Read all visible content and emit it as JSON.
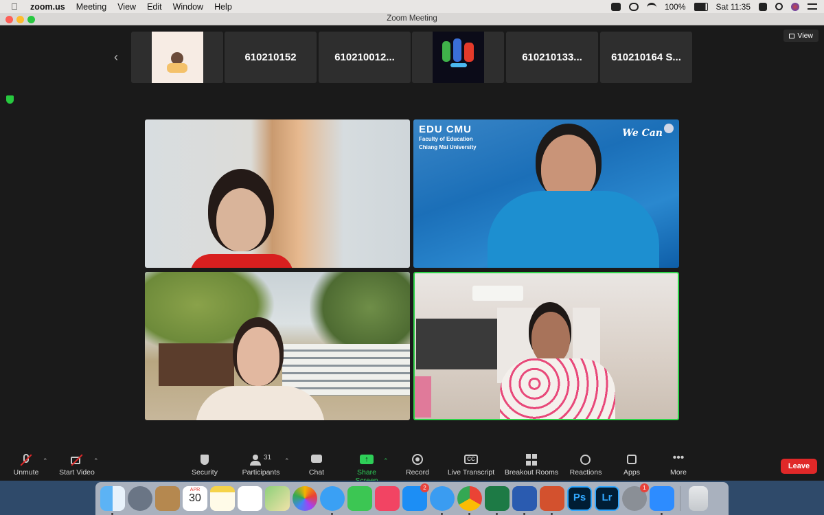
{
  "menubar": {
    "app": "zoom.us",
    "menus": [
      "Meeting",
      "View",
      "Edit",
      "Window",
      "Help"
    ],
    "battery": "100%",
    "clock": "Sat 11:35"
  },
  "window": {
    "title": "Zoom Meeting"
  },
  "view_button": "View",
  "thumbnails": [
    "610210152",
    "610210012...",
    "610210133...",
    "610210164 S..."
  ],
  "tiles": {
    "edu_title": "EDU CMU",
    "edu_line1": "Faculty of Education",
    "edu_line2": "Chiang Mai University",
    "we_can": "We Can"
  },
  "toolbar": {
    "unmute": "Unmute",
    "start_video": "Start Video",
    "security": "Security",
    "participants": "Participants",
    "participants_count": "31",
    "chat": "Chat",
    "share_screen": "Share Screen",
    "record": "Record",
    "live_transcript": "Live Transcript",
    "breakout_rooms": "Breakout Rooms",
    "reactions": "Reactions",
    "apps": "Apps",
    "more": "More",
    "leave": "Leave",
    "cc": "CC"
  },
  "dock": {
    "calendar_month": "APR",
    "calendar_day": "30",
    "appstore_badge": "2",
    "settings_badge": "1",
    "ps": "Ps",
    "lr": "Lr"
  },
  "colors": {
    "accent_green": "#2ecf58",
    "leave_red": "#e02828",
    "active_border": "#2fd44a"
  }
}
